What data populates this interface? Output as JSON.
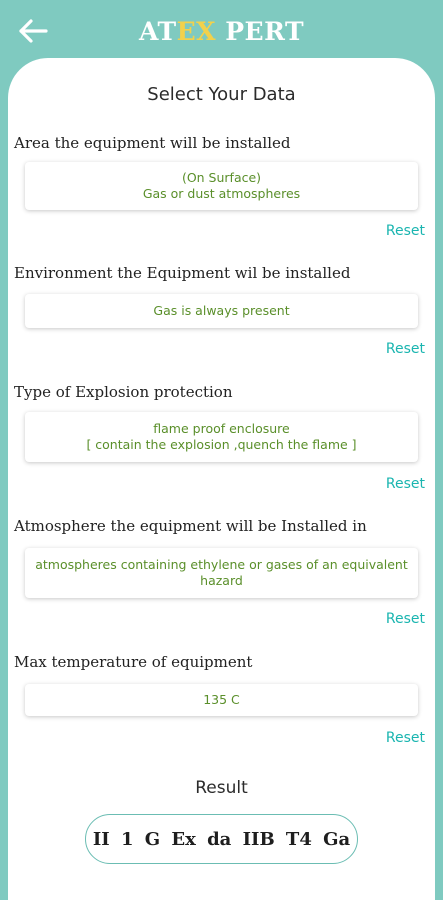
{
  "header": {
    "title_part1": "AT",
    "title_part2": "EX",
    "title_part3": "PERT",
    "back_icon": "arrow-left-icon",
    "colors": {
      "background": "#7fcac0",
      "title_white": "#ffffff",
      "title_accent": "#f2d14b"
    }
  },
  "page_title": "Select Your Data",
  "sections": [
    {
      "label": "Area the equipment will be installed",
      "value": "(On Surface)\nGas or dust atmospheres",
      "reset": "Reset"
    },
    {
      "label": "Environment the Equipment wil be installed",
      "value": "Gas is always present",
      "reset": "Reset"
    },
    {
      "label": "Type of Explosion protection",
      "value": "flame proof enclosure\n[ contain the explosion ,quench the flame ]",
      "reset": "Reset"
    },
    {
      "label": "Atmosphere the equipment will be Installed in",
      "value": "atmospheres containing ethylene or gases of an equivalent hazard",
      "reset": "Reset"
    },
    {
      "label": "Max temperature of equipment",
      "value": "135 C",
      "reset": "Reset"
    }
  ],
  "result": {
    "label": "Result",
    "value": "II 1 G Ex da IIB T4 Ga"
  },
  "colors": {
    "value_text": "#5a8f2a",
    "reset_text": "#1ab5b0",
    "pill_border": "#6bbdb3"
  }
}
